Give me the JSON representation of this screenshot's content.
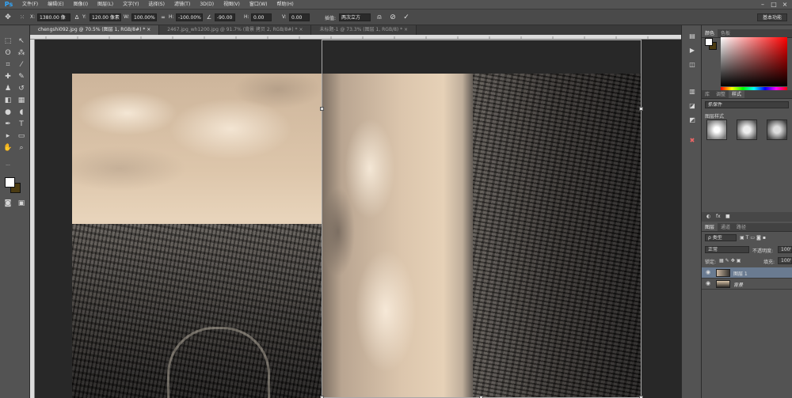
{
  "menu": {
    "logo": "Ps",
    "items": [
      "文件(F)",
      "编辑(E)",
      "图像(I)",
      "图层(L)",
      "文字(Y)",
      "选择(S)",
      "滤镜(T)",
      "3D(D)",
      "视图(V)",
      "窗口(W)",
      "帮助(H)"
    ],
    "minimize": "–",
    "maximize": "□",
    "close": "×"
  },
  "options": {
    "x_label": "X:",
    "x_value": "1380.00 像",
    "y_label": "Y:",
    "y_value": "120.00 像素",
    "w_label": "W:",
    "w_value": "100.00%",
    "h_label": "H:",
    "h_value": "-100.00%",
    "angle_value": "-90.00",
    "hskew_label": "H:",
    "hskew_value": "0.00",
    "vskew_label": "V:",
    "vskew_value": "0.00",
    "interp_label": "插值:",
    "interp_value": "两次立方",
    "workspace": "基本功能"
  },
  "tabs": [
    "chengshi092.jpg @ 70.5% (图层 1, RGB/8#) * ×",
    "2467.jpg_wh1200.jpg @ 91.7% (背景 拷贝 2, RGB/8#) * ×",
    "未标题-1 @ 73.3% (图层 1, RGB/8) * ×"
  ],
  "panels": {
    "color_tabs": [
      "颜色",
      "色板"
    ],
    "style_tabs": [
      "库",
      "调整",
      "样式"
    ],
    "style_dropdown": "抓保件",
    "style_section": "图层样式",
    "layers_tabs": [
      "图层",
      "通道",
      "路径"
    ],
    "filter_kind": "ρ 类型",
    "blend_mode": "正常",
    "opacity_label": "不透明度:",
    "opacity_value": "100%",
    "lock_label": "锁定:",
    "fill_label": "填充:",
    "fill_value": "100%",
    "layers": [
      {
        "name": "图层 1"
      },
      {
        "name": "背景"
      }
    ]
  },
  "colors": {
    "accent": "#31a8ff",
    "foreground": "#ffffff",
    "background": "#4b3b12"
  }
}
